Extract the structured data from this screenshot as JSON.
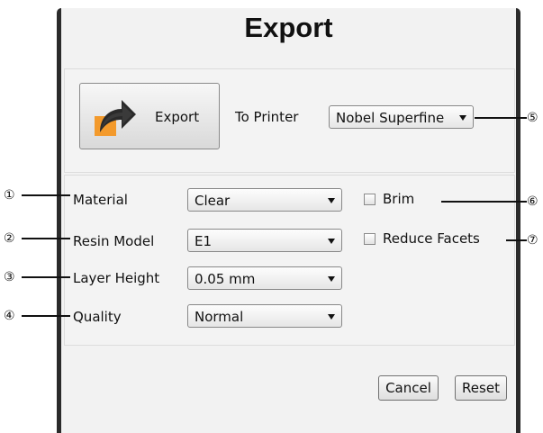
{
  "dialog": {
    "title": "Export",
    "export_button_label": "Export",
    "to_printer_label": "To Printer",
    "printer_select": "Nobel Superfine",
    "material_label": "Material",
    "material_select": "Clear",
    "resin_model_label": "Resin Model",
    "resin_model_select": "E1",
    "layer_height_label": "Layer Height",
    "layer_height_select": "0.05 mm",
    "quality_label": "Quality",
    "quality_select": "Normal",
    "brim_label": "Brim",
    "reduce_facets_label": "Reduce Facets",
    "cancel_label": "Cancel",
    "reset_label": "Reset"
  },
  "callouts": {
    "c1": "①",
    "c2": "②",
    "c3": "③",
    "c4": "④",
    "c5": "⑤",
    "c6": "⑥",
    "c7": "⑦"
  },
  "colors": {
    "arrow_orange": "#f39a2c",
    "arrow_dark": "#2a2a2a"
  }
}
